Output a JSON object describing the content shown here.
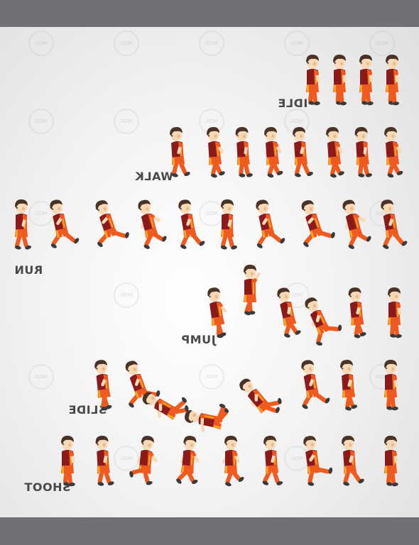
{
  "labels": {
    "idle": "IDLE",
    "walk": "WALK",
    "run": "RUN",
    "jump": "JUMP",
    "slide": "SLIDE",
    "shoot": "SHOOT"
  },
  "watermark_text": "GDM",
  "colors": {
    "bar": "#707174",
    "label": "#48494c",
    "jersey_main": "#f05a1e",
    "jersey_dark": "#8c1a1a",
    "jersey_stripe": "#f6a322",
    "skin": "#f8d9b6",
    "hair": "#4a3326",
    "shoe": "#3a3a3a"
  },
  "sprite_names": {
    "idle": [
      "idle-frame-1",
      "idle-frame-2",
      "idle-frame-3",
      "idle-frame-4"
    ],
    "walk": [
      "walk-frame-1",
      "walk-frame-2",
      "walk-frame-3",
      "walk-frame-4",
      "walk-frame-5",
      "walk-frame-6",
      "walk-frame-7",
      "walk-frame-8",
      "walk-frame-9"
    ],
    "run": [
      "run-frame-1",
      "run-frame-2",
      "run-frame-3",
      "run-frame-4",
      "run-frame-5",
      "run-frame-6",
      "run-frame-7",
      "run-frame-8",
      "run-frame-9",
      "run-frame-10"
    ],
    "jump": [
      "jump-frame-1",
      "jump-frame-2",
      "jump-frame-3",
      "jump-frame-4",
      "jump-frame-5",
      "jump-frame-6"
    ],
    "slide": [
      "slide-frame-1",
      "slide-frame-2",
      "slide-frame-3",
      "slide-frame-4",
      "slide-frame-5",
      "slide-frame-6",
      "slide-frame-7",
      "slide-frame-8"
    ],
    "shoot": [
      "shoot-frame-1",
      "shoot-frame-2",
      "shoot-frame-3",
      "shoot-frame-4",
      "shoot-frame-5",
      "shoot-frame-6",
      "shoot-frame-7",
      "shoot-frame-8",
      "shoot-frame-9"
    ]
  }
}
